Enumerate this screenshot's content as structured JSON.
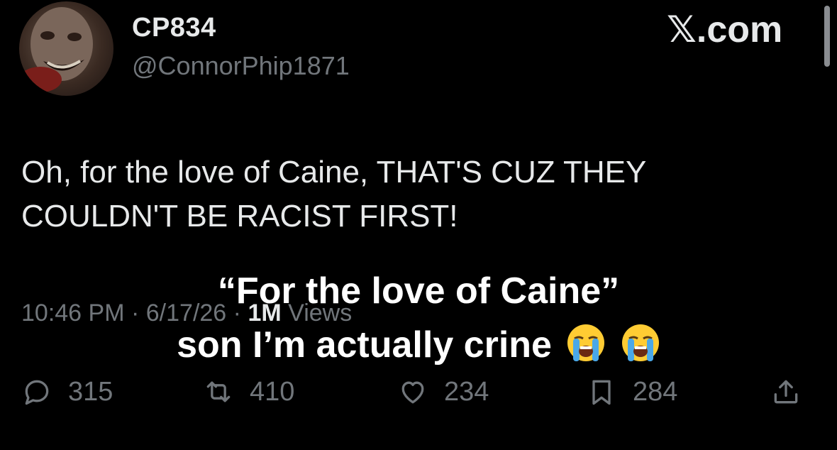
{
  "author": {
    "display_name": "CP834",
    "handle": "@ConnorPhip1871"
  },
  "site": {
    "logo": "𝕏.com"
  },
  "tweet": {
    "text": "Oh, for the love of Caine, THAT'S CUZ THEY COULDN'T BE RACIST FIRST!",
    "time": "10:46 PM",
    "date": "6/17/26",
    "views_count": "1M",
    "views_label": "Views"
  },
  "caption": {
    "line1": "“For the love of Caine”",
    "line2": "son I’m actually crine",
    "emoji": "loudly-crying-face-emoji"
  },
  "actions": {
    "replies": "315",
    "reposts": "410",
    "likes": "234",
    "bookmarks": "284"
  },
  "icons": {
    "reply": "reply-icon",
    "repost": "repost-icon",
    "like": "heart-icon",
    "bookmark": "bookmark-icon",
    "share": "share-icon"
  },
  "colors": {
    "background": "#000000",
    "primary_text": "#e7e9ea",
    "secondary_text": "#71767b",
    "caption_text": "#ffffff"
  }
}
